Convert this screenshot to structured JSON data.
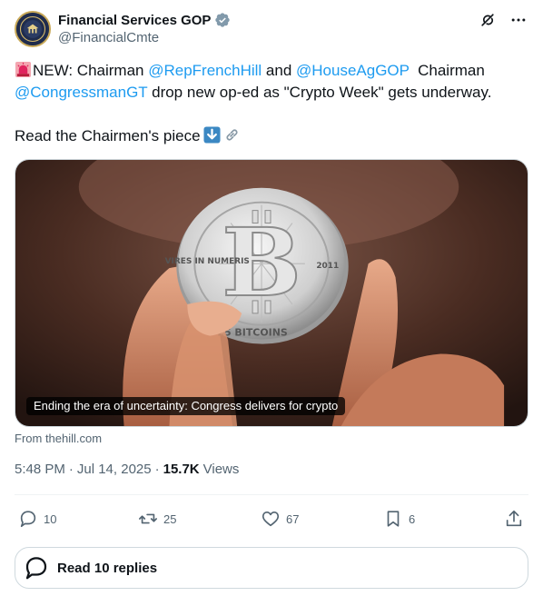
{
  "author": {
    "display_name": "Financial Services GOP",
    "handle": "@FinancialCmte",
    "verified": true,
    "avatar_icon": "house-seal-icon"
  },
  "header_actions": [
    "grok-icon",
    "more-icon"
  ],
  "tweet": {
    "line1_prefix": "NEW: Chairman ",
    "mention1": "@RepFrenchHill",
    "line1_mid": " and ",
    "mention2": "@HouseAgGOP",
    "line1_suffix": "  Chairman",
    "mention3": "@CongressmanGT",
    "line2_suffix": " drop new op-ed as \"Crypto Week\" gets underway.",
    "line3": "Read the Chairmen's piece",
    "emojis": [
      "siren-emoji",
      "down-arrow-emoji",
      "link-emoji"
    ]
  },
  "card": {
    "caption": "Ending the era of uncertainty: Congress delivers for crypto",
    "source": "From thehill.com",
    "coin_text": {
      "left": "VIRES IN NUMERIS",
      "right": "2011",
      "bottom": "25 BITCOINS"
    }
  },
  "meta": {
    "time": "5:48 PM",
    "sep1": "·",
    "date": "Jul 14, 2025",
    "sep2": "·",
    "views_count": "15.7K",
    "views_label": "Views"
  },
  "actions": {
    "replies": "10",
    "reposts": "25",
    "likes": "67",
    "bookmarks": "6"
  },
  "read_replies_label": "Read 10 replies",
  "colors": {
    "accent": "#1d9bf0",
    "text": "#0f1419",
    "muted": "#536471",
    "border": "#cfd9de"
  }
}
